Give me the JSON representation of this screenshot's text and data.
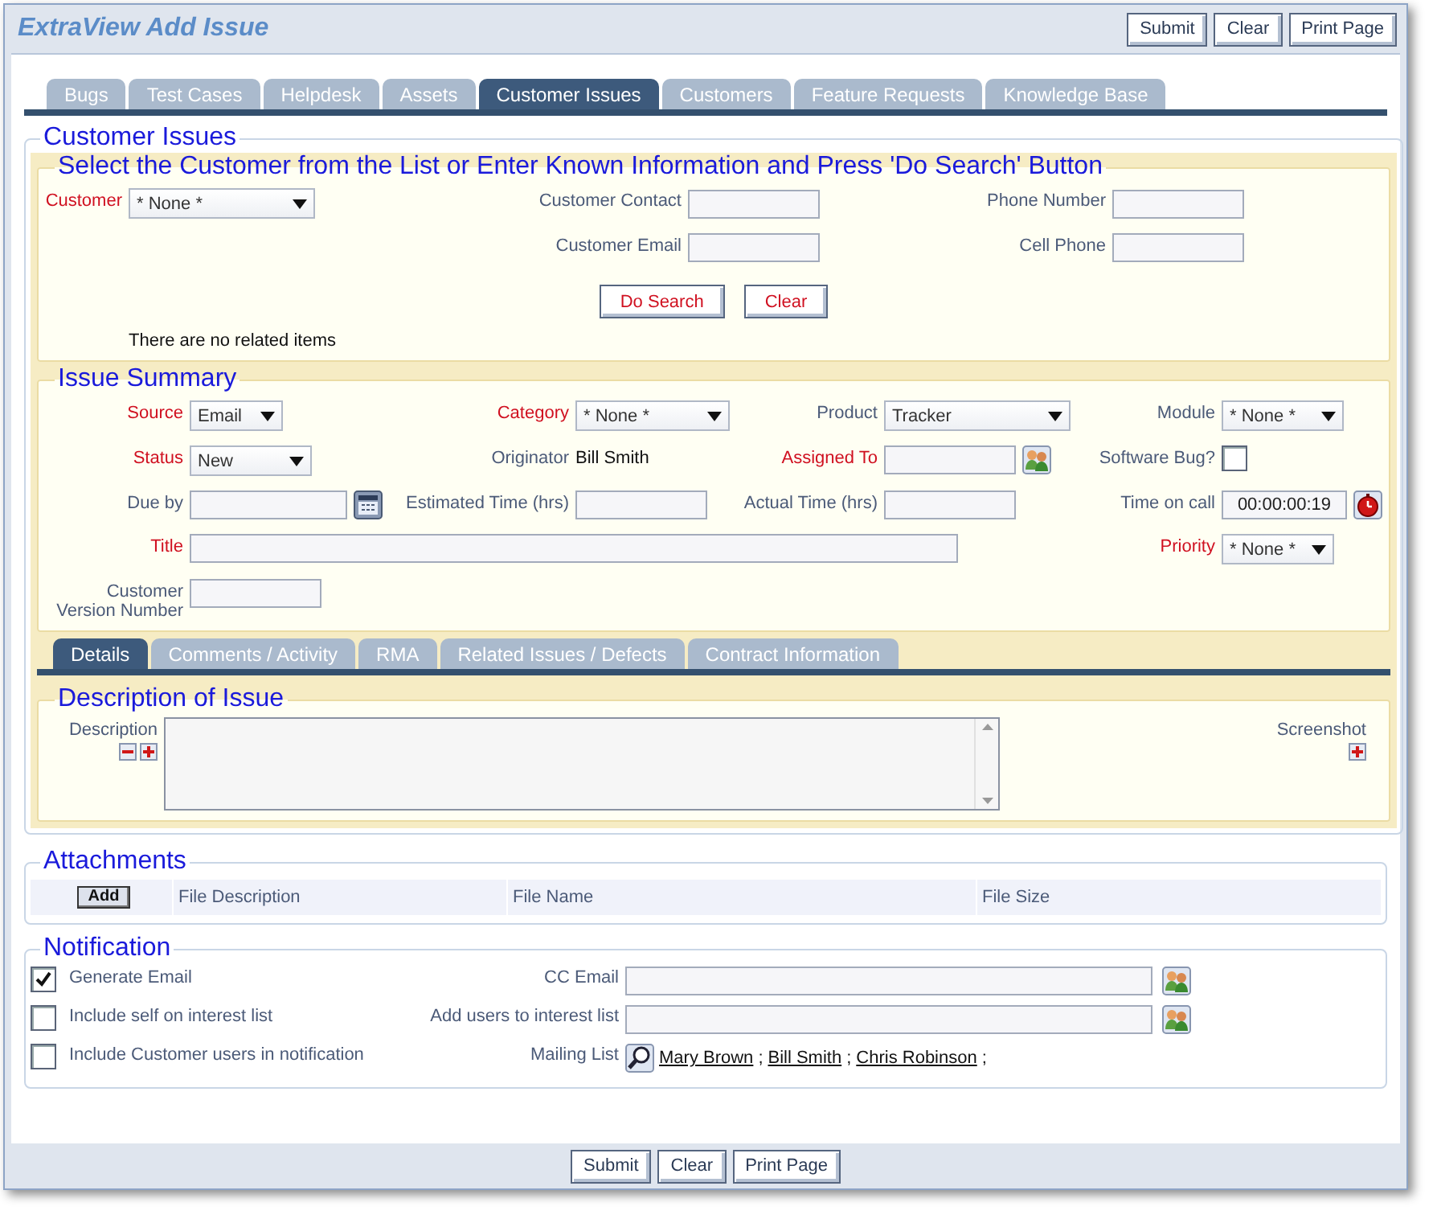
{
  "window": {
    "title": "ExtraView Add Issue"
  },
  "top_buttons": [
    "Submit",
    "Clear",
    "Print Page"
  ],
  "tabs": [
    {
      "label": "Bugs",
      "selected": false
    },
    {
      "label": "Test Cases",
      "selected": false
    },
    {
      "label": "Helpdesk",
      "selected": false
    },
    {
      "label": "Assets",
      "selected": false
    },
    {
      "label": "Customer Issues",
      "selected": true
    },
    {
      "label": "Customers",
      "selected": false
    },
    {
      "label": "Feature Requests",
      "selected": false
    },
    {
      "label": "Knowledge Base",
      "selected": false
    }
  ],
  "customer_section": {
    "title": "Customer Issues",
    "subtitle": "Select the Customer from the List or Enter Known Information and Press 'Do Search' Button",
    "columns": [
      [
        {
          "label": "Customer",
          "required": true,
          "kind": "select",
          "value": "* None *"
        }
      ],
      [
        {
          "label": "Customer Contact",
          "required": false,
          "kind": "text"
        },
        {
          "label": "Customer Email",
          "required": false,
          "kind": "text"
        }
      ],
      [
        {
          "label": "Phone Number",
          "required": false,
          "kind": "text"
        },
        {
          "label": "Cell Phone",
          "required": false,
          "kind": "text"
        }
      ]
    ],
    "buttons": [
      "Do Search",
      "Clear"
    ],
    "message": "There are no related items"
  },
  "issue_summary": {
    "title": "Issue Summary",
    "rows": [
      [
        {
          "label": "Source",
          "required": true,
          "kind": "select",
          "value": "Email"
        },
        {
          "label": "Category",
          "required": true,
          "kind": "select",
          "value": "* None *"
        },
        {
          "label": "Product",
          "required": false,
          "kind": "select",
          "value": "Tracker"
        },
        {
          "label": "Module",
          "required": false,
          "kind": "select",
          "value": "* None *"
        }
      ],
      [
        {
          "label": "Status",
          "required": true,
          "kind": "select",
          "value": "New"
        },
        {
          "label": "Originator",
          "required": false,
          "kind": "static",
          "value": "Bill Smith"
        },
        {
          "label": "Assigned To",
          "required": true,
          "kind": "picker"
        },
        {
          "label": "Software Bug?",
          "required": false,
          "kind": "checkbox",
          "checked": false
        }
      ],
      [
        {
          "label": "Due by",
          "required": false,
          "kind": "date"
        },
        {
          "label": "Estimated Time (hrs)",
          "required": false,
          "kind": "text"
        },
        {
          "label": "Actual Time (hrs)",
          "required": false,
          "kind": "text"
        },
        {
          "label": "Time on call",
          "required": false,
          "kind": "timer",
          "value": "00:00:00:19"
        }
      ],
      [
        {
          "label": "Title",
          "required": true,
          "kind": "wide_text"
        },
        "",
        "",
        {
          "label": "Priority",
          "required": true,
          "kind": "select",
          "value": "* None *"
        }
      ],
      [
        {
          "label": "Customer Version Number",
          "required": false,
          "kind": "text"
        }
      ]
    ]
  },
  "sub_tabs": [
    {
      "label": "Details",
      "selected": true
    },
    {
      "label": "Comments / Activity",
      "selected": false
    },
    {
      "label": "RMA",
      "selected": false
    },
    {
      "label": "Related Issues / Defects",
      "selected": false
    },
    {
      "label": "Contract Information",
      "selected": false
    }
  ],
  "description": {
    "title": "Description of Issue",
    "label": "Description",
    "screenshot_label": "Screenshot"
  },
  "attachments": {
    "title": "Attachments",
    "add_button": "Add",
    "columns": [
      "File Description",
      "File Name",
      "File Size"
    ]
  },
  "notification": {
    "title": "Notification",
    "options": [
      {
        "label": "Generate Email",
        "checked": true
      },
      {
        "label": "Include self on interest list",
        "checked": false
      },
      {
        "label": "Include Customer users in notification",
        "checked": false
      }
    ],
    "fields": [
      {
        "label": "CC Email",
        "kind": "picker"
      },
      {
        "label": "Add users to interest list",
        "kind": "picker"
      },
      {
        "label": "Mailing List",
        "kind": "mailing",
        "links": [
          {
            "name": "Mary Brown",
            "after": ";"
          },
          {
            "name": "Bill Smith",
            "after": ";"
          },
          {
            "name": "Chris Robinson",
            "after": ";"
          }
        ]
      }
    ]
  },
  "footer_buttons": [
    "Submit",
    "Clear",
    "Print Page"
  ]
}
